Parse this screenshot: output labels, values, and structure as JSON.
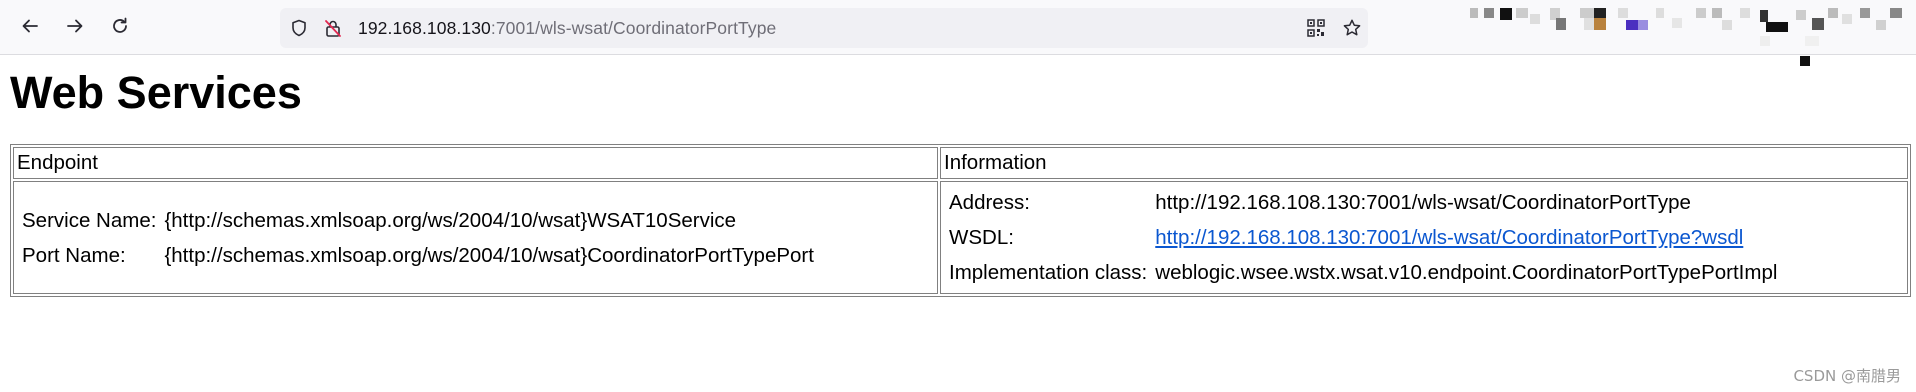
{
  "browser": {
    "url": {
      "host": "192.168.108.130",
      "rest": ":7001/wls-wsat/CoordinatorPortType"
    },
    "icons": {
      "back": "arrow-left-icon",
      "forward": "arrow-right-icon",
      "reload": "reload-icon",
      "tracking": "shield-icon",
      "security": "insecure-lock-icon",
      "qr": "qr-code-icon",
      "bookmark": "star-icon"
    }
  },
  "page": {
    "title": "Web Services",
    "table": {
      "headers": [
        "Endpoint",
        "Information"
      ],
      "endpoint": [
        {
          "label": "Service Name:",
          "value": "{http://schemas.xmlsoap.org/ws/2004/10/wsat}WSAT10Service"
        },
        {
          "label": "Port Name:",
          "value": "{http://schemas.xmlsoap.org/ws/2004/10/wsat}CoordinatorPortTypePort"
        }
      ],
      "information": [
        {
          "label": "Address:",
          "value": "http://192.168.108.130:7001/wls-wsat/CoordinatorPortType"
        },
        {
          "label": "WSDL:",
          "value": "http://192.168.108.130:7001/wls-wsat/CoordinatorPortType?wsdl"
        },
        {
          "label": "Implementation class:",
          "value": "weblogic.wsee.wstx.wsat.v10.endpoint.CoordinatorPortTypePortImpl"
        }
      ]
    }
  },
  "watermark": "CSDN @南腊男",
  "colors": {
    "link": "#0b57d0",
    "toolbar_bg": "#f9f9fb",
    "urlbar_bg": "#f0f0f4",
    "insecure": "#e22850"
  }
}
